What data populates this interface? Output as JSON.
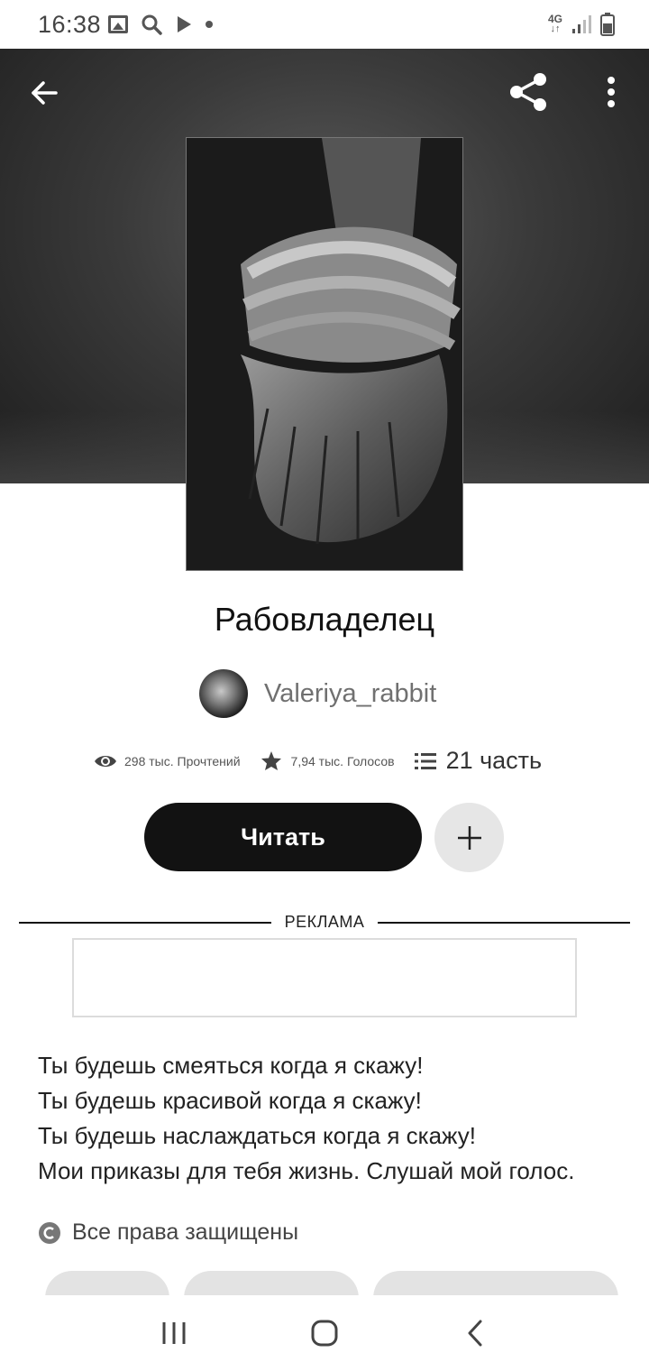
{
  "status_bar": {
    "time": "16:38",
    "network": "4G",
    "icons": [
      "gallery-icon",
      "search-icon",
      "play-icon",
      "dot-icon",
      "signal-icon",
      "battery-icon"
    ]
  },
  "header": {
    "back_icon": "arrow-left-icon",
    "share_icon": "share-icon",
    "menu_icon": "more-vert-icon"
  },
  "story": {
    "title": "Рабовладелец",
    "author": "Valeriya_rabbit",
    "stats": {
      "reads": "298 тыс. Прочтений",
      "votes": "7,94 тыс. Голосов",
      "parts": "21 часть"
    },
    "read_button": "Читать",
    "add_button_icon": "plus-icon",
    "ad_label": "РЕКЛАМА",
    "description": [
      "Ты будешь смеяться когда я скажу!",
      "Ты будешь красивой когда я скажу!",
      "Ты будешь наслаждаться когда я скажу!",
      "Мои приказы для тебя жизнь. Слушай мой голос."
    ],
    "rights": "Все права защищены"
  },
  "navbar": {
    "recents_icon": "recents-icon",
    "home_icon": "home-icon",
    "back_icon": "chevron-left-icon"
  },
  "colors": {
    "button_dark": "#121212",
    "button_light": "#e6e6e6",
    "muted_text": "#707070"
  }
}
